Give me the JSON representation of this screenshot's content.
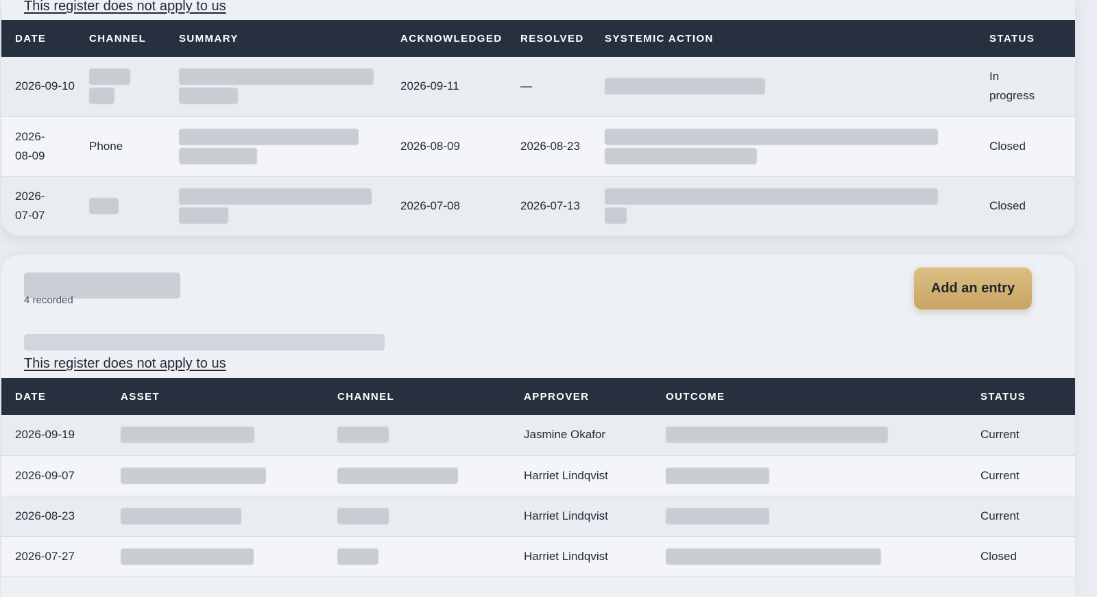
{
  "register1": {
    "optout_label": "This register does not apply to us",
    "columns": {
      "date": "DATE",
      "channel": "CHANNEL",
      "summary": "SUMMARY",
      "acknowledged": "ACKNOWLEDGED",
      "resolved": "RESOLVED",
      "systemic_action": "SYSTEMIC ACTION",
      "status": "STATUS"
    },
    "rows": [
      {
        "date": "2026-09-10",
        "channel": "",
        "acknowledged": "2026-09-11",
        "resolved": "—",
        "status": "In progress"
      },
      {
        "date": "2026-08-09",
        "channel": "Phone",
        "acknowledged": "2026-08-09",
        "resolved": "2026-08-23",
        "status": "Closed"
      },
      {
        "date": "2026-07-07",
        "channel": "",
        "acknowledged": "2026-07-08",
        "resolved": "2026-07-13",
        "status": "Closed"
      }
    ]
  },
  "register2": {
    "count_label": "4 recorded",
    "add_button_label": "Add an entry",
    "optout_label": "This register does not apply to us",
    "columns": {
      "date": "DATE",
      "asset": "ASSET",
      "channel": "CHANNEL",
      "approver": "APPROVER",
      "outcome": "OUTCOME",
      "status": "STATUS"
    },
    "rows": [
      {
        "date": "2026-09-19",
        "approver": "Jasmine Okafor",
        "status": "Current"
      },
      {
        "date": "2026-09-07",
        "approver": "Harriet Lindqvist",
        "status": "Current"
      },
      {
        "date": "2026-08-23",
        "approver": "Harriet Lindqvist",
        "status": "Current"
      },
      {
        "date": "2026-07-27",
        "approver": "Harriet Lindqvist",
        "status": "Closed"
      }
    ]
  },
  "colors": {
    "header_bg": "#27303f",
    "accent_button": "#d4b374",
    "redacted": "#c9cdd3"
  }
}
